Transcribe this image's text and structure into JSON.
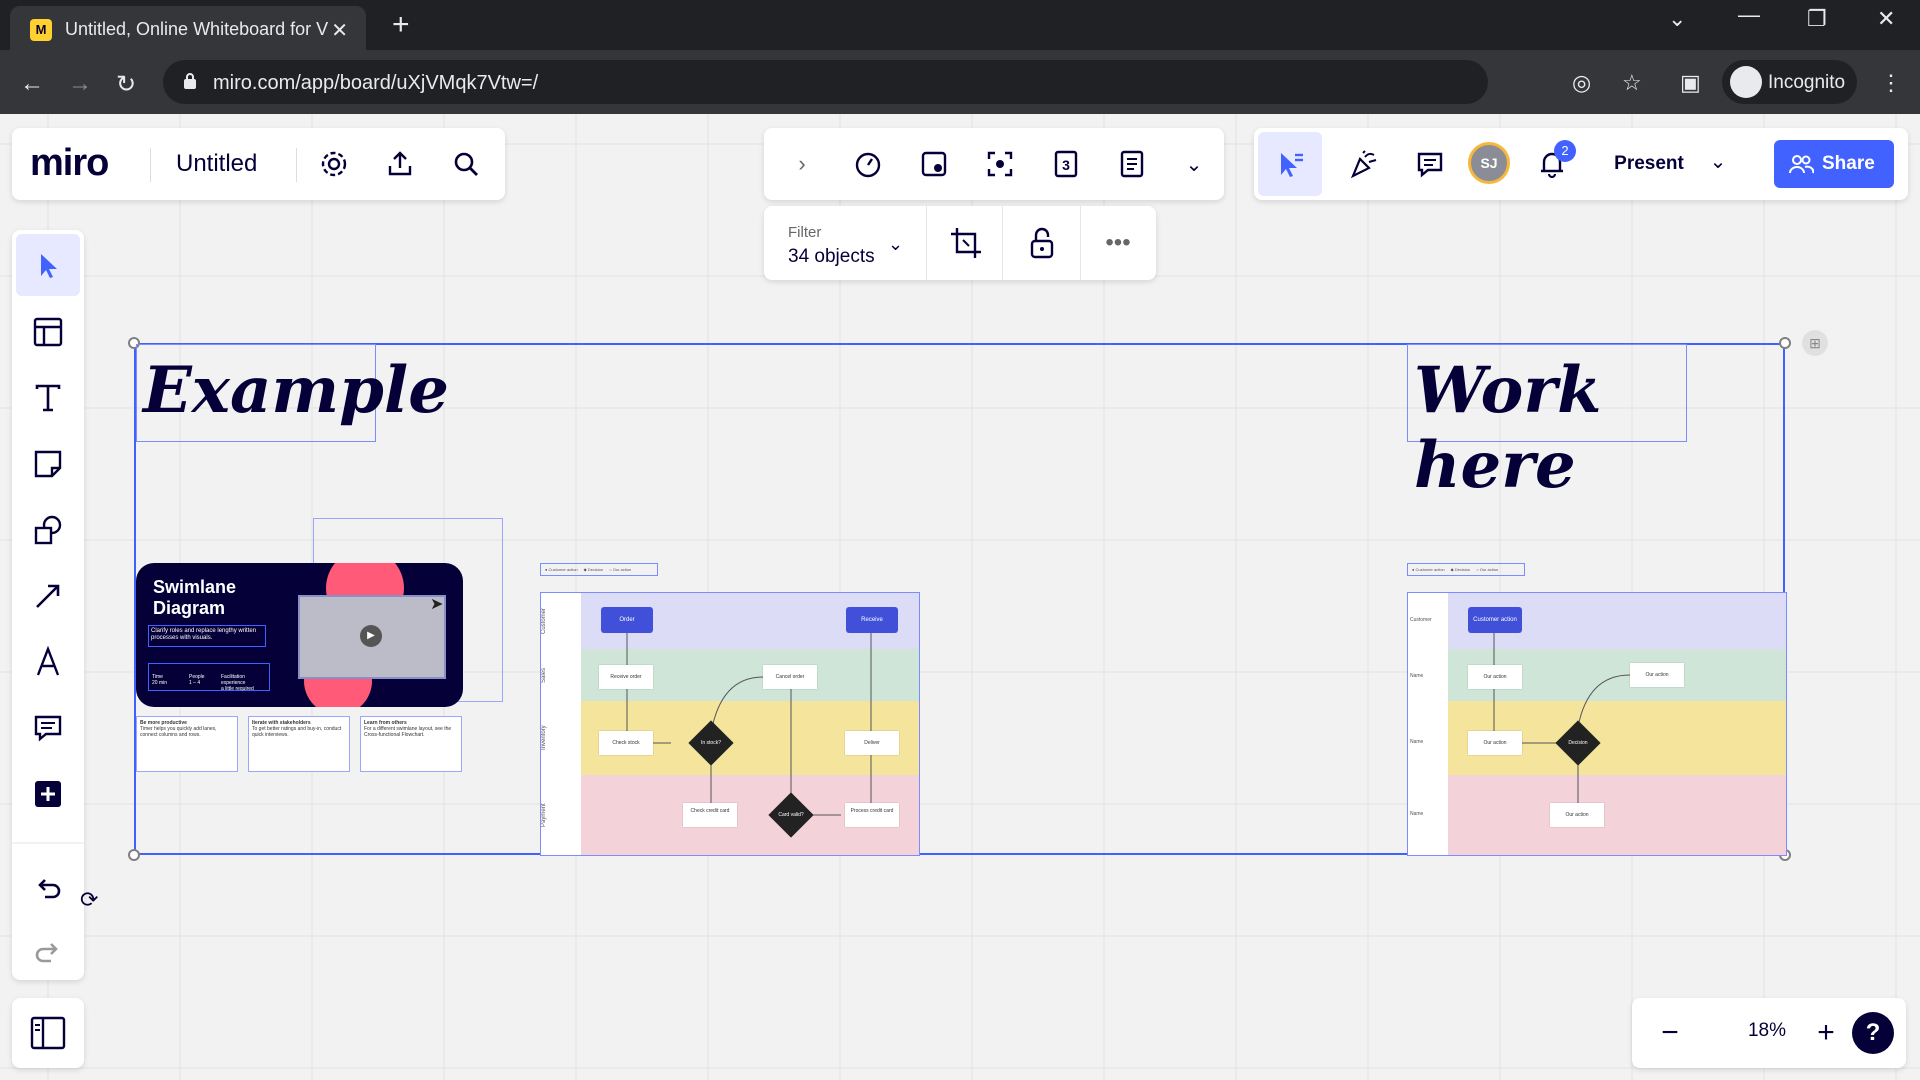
{
  "browser": {
    "tab_title": "Untitled, Online Whiteboard for V",
    "url": "miro.com/app/board/uXjVMqk7Vtw=/",
    "profile_label": "Incognito"
  },
  "board": {
    "logo": "miro",
    "name": "Untitled",
    "present_label": "Present",
    "share_label": "Share",
    "avatar_initials": "SJ",
    "notification_count": "2",
    "filter_label": "Filter",
    "filter_value": "34 objects",
    "zoom_level": "18%",
    "help_label": "?"
  },
  "frames": {
    "example_title": "Example",
    "work_title": "Work here"
  },
  "template_card": {
    "title_line1": "Swimlane",
    "title_line2": "Diagram",
    "desc": "Clarify roles and replace lengthy written processes with visuals.",
    "stat1_top": "Time",
    "stat1_val": "20 min",
    "stat2_top": "People",
    "stat2_val": "1 – 4",
    "stat3_top": "Facilitation experience",
    "stat3_val": "a little required",
    "tips": [
      {
        "title": "Be more productive",
        "body": "Timer helps you quickly add lanes, connect columns and rows."
      },
      {
        "title": "Iterate with stakeholders",
        "body": "To get better ratings and buy-in, conduct quick interviews."
      },
      {
        "title": "Learn from others",
        "body": "For a different swimlane layout, see the Cross-functional Flowchart."
      }
    ]
  },
  "example_diagram": {
    "legend": [
      "Customer action",
      "Decision",
      "Our action"
    ],
    "lanes": [
      "Customer",
      "Sales",
      "Inventory",
      "Payment"
    ],
    "cards": {
      "order": "Order",
      "receive": "Receive",
      "receive_order": "Receive order",
      "cancel_order": "Cancel order",
      "check_stock": "Check stock",
      "in_stock": "In stock?",
      "deliver": "Deliver",
      "check_card": "Check credit card",
      "card_valid": "Card valid?",
      "process_card": "Process credit card"
    }
  },
  "work_diagram": {
    "legend": [
      "Customer action",
      "Decision",
      "Our action"
    ],
    "lanes": [
      "Customer",
      "Name",
      "Name",
      "Name"
    ],
    "cards": {
      "customer_action": "Customer action",
      "our_action": "Our action",
      "decision": "Decision"
    }
  },
  "colors": {
    "accent": "#4262ff",
    "share_button": "#4262ff",
    "lane_purple": "#dcdcf7",
    "lane_green": "#cfe5d8",
    "lane_yellow": "#f4e49c",
    "lane_pink": "#f3d2d9",
    "template_bg": "#050038",
    "template_pink": "#ff5a78"
  }
}
